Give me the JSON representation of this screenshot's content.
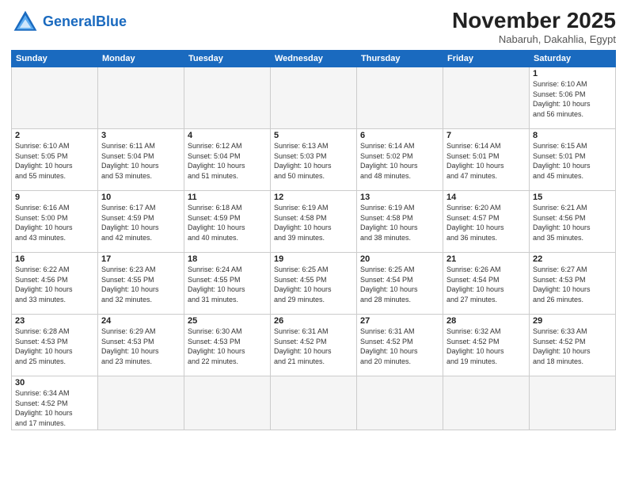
{
  "header": {
    "logo_general": "General",
    "logo_blue": "Blue",
    "month_title": "November 2025",
    "location": "Nabaruh, Dakahlia, Egypt"
  },
  "weekdays": [
    "Sunday",
    "Monday",
    "Tuesday",
    "Wednesday",
    "Thursday",
    "Friday",
    "Saturday"
  ],
  "days": [
    {
      "num": "",
      "info": "",
      "empty": true
    },
    {
      "num": "",
      "info": "",
      "empty": true
    },
    {
      "num": "",
      "info": "",
      "empty": true
    },
    {
      "num": "",
      "info": "",
      "empty": true
    },
    {
      "num": "",
      "info": "",
      "empty": true
    },
    {
      "num": "",
      "info": "",
      "empty": true
    },
    {
      "num": "1",
      "info": "Sunrise: 6:10 AM\nSunset: 5:06 PM\nDaylight: 10 hours\nand 56 minutes."
    },
    {
      "num": "2",
      "info": "Sunrise: 6:10 AM\nSunset: 5:05 PM\nDaylight: 10 hours\nand 55 minutes."
    },
    {
      "num": "3",
      "info": "Sunrise: 6:11 AM\nSunset: 5:04 PM\nDaylight: 10 hours\nand 53 minutes."
    },
    {
      "num": "4",
      "info": "Sunrise: 6:12 AM\nSunset: 5:04 PM\nDaylight: 10 hours\nand 51 minutes."
    },
    {
      "num": "5",
      "info": "Sunrise: 6:13 AM\nSunset: 5:03 PM\nDaylight: 10 hours\nand 50 minutes."
    },
    {
      "num": "6",
      "info": "Sunrise: 6:14 AM\nSunset: 5:02 PM\nDaylight: 10 hours\nand 48 minutes."
    },
    {
      "num": "7",
      "info": "Sunrise: 6:14 AM\nSunset: 5:01 PM\nDaylight: 10 hours\nand 47 minutes."
    },
    {
      "num": "8",
      "info": "Sunrise: 6:15 AM\nSunset: 5:01 PM\nDaylight: 10 hours\nand 45 minutes."
    },
    {
      "num": "9",
      "info": "Sunrise: 6:16 AM\nSunset: 5:00 PM\nDaylight: 10 hours\nand 43 minutes."
    },
    {
      "num": "10",
      "info": "Sunrise: 6:17 AM\nSunset: 4:59 PM\nDaylight: 10 hours\nand 42 minutes."
    },
    {
      "num": "11",
      "info": "Sunrise: 6:18 AM\nSunset: 4:59 PM\nDaylight: 10 hours\nand 40 minutes."
    },
    {
      "num": "12",
      "info": "Sunrise: 6:19 AM\nSunset: 4:58 PM\nDaylight: 10 hours\nand 39 minutes."
    },
    {
      "num": "13",
      "info": "Sunrise: 6:19 AM\nSunset: 4:58 PM\nDaylight: 10 hours\nand 38 minutes."
    },
    {
      "num": "14",
      "info": "Sunrise: 6:20 AM\nSunset: 4:57 PM\nDaylight: 10 hours\nand 36 minutes."
    },
    {
      "num": "15",
      "info": "Sunrise: 6:21 AM\nSunset: 4:56 PM\nDaylight: 10 hours\nand 35 minutes."
    },
    {
      "num": "16",
      "info": "Sunrise: 6:22 AM\nSunset: 4:56 PM\nDaylight: 10 hours\nand 33 minutes."
    },
    {
      "num": "17",
      "info": "Sunrise: 6:23 AM\nSunset: 4:55 PM\nDaylight: 10 hours\nand 32 minutes."
    },
    {
      "num": "18",
      "info": "Sunrise: 6:24 AM\nSunset: 4:55 PM\nDaylight: 10 hours\nand 31 minutes."
    },
    {
      "num": "19",
      "info": "Sunrise: 6:25 AM\nSunset: 4:55 PM\nDaylight: 10 hours\nand 29 minutes."
    },
    {
      "num": "20",
      "info": "Sunrise: 6:25 AM\nSunset: 4:54 PM\nDaylight: 10 hours\nand 28 minutes."
    },
    {
      "num": "21",
      "info": "Sunrise: 6:26 AM\nSunset: 4:54 PM\nDaylight: 10 hours\nand 27 minutes."
    },
    {
      "num": "22",
      "info": "Sunrise: 6:27 AM\nSunset: 4:53 PM\nDaylight: 10 hours\nand 26 minutes."
    },
    {
      "num": "23",
      "info": "Sunrise: 6:28 AM\nSunset: 4:53 PM\nDaylight: 10 hours\nand 25 minutes."
    },
    {
      "num": "24",
      "info": "Sunrise: 6:29 AM\nSunset: 4:53 PM\nDaylight: 10 hours\nand 23 minutes."
    },
    {
      "num": "25",
      "info": "Sunrise: 6:30 AM\nSunset: 4:53 PM\nDaylight: 10 hours\nand 22 minutes."
    },
    {
      "num": "26",
      "info": "Sunrise: 6:31 AM\nSunset: 4:52 PM\nDaylight: 10 hours\nand 21 minutes."
    },
    {
      "num": "27",
      "info": "Sunrise: 6:31 AM\nSunset: 4:52 PM\nDaylight: 10 hours\nand 20 minutes."
    },
    {
      "num": "28",
      "info": "Sunrise: 6:32 AM\nSunset: 4:52 PM\nDaylight: 10 hours\nand 19 minutes."
    },
    {
      "num": "29",
      "info": "Sunrise: 6:33 AM\nSunset: 4:52 PM\nDaylight: 10 hours\nand 18 minutes."
    },
    {
      "num": "30",
      "info": "Sunrise: 6:34 AM\nSunset: 4:52 PM\nDaylight: 10 hours\nand 17 minutes.",
      "last_row": true
    },
    {
      "num": "",
      "info": "",
      "empty": true,
      "last_row": true
    },
    {
      "num": "",
      "info": "",
      "empty": true,
      "last_row": true
    },
    {
      "num": "",
      "info": "",
      "empty": true,
      "last_row": true
    },
    {
      "num": "",
      "info": "",
      "empty": true,
      "last_row": true
    },
    {
      "num": "",
      "info": "",
      "empty": true,
      "last_row": true
    },
    {
      "num": "",
      "info": "",
      "empty": true,
      "last_row": true
    }
  ]
}
